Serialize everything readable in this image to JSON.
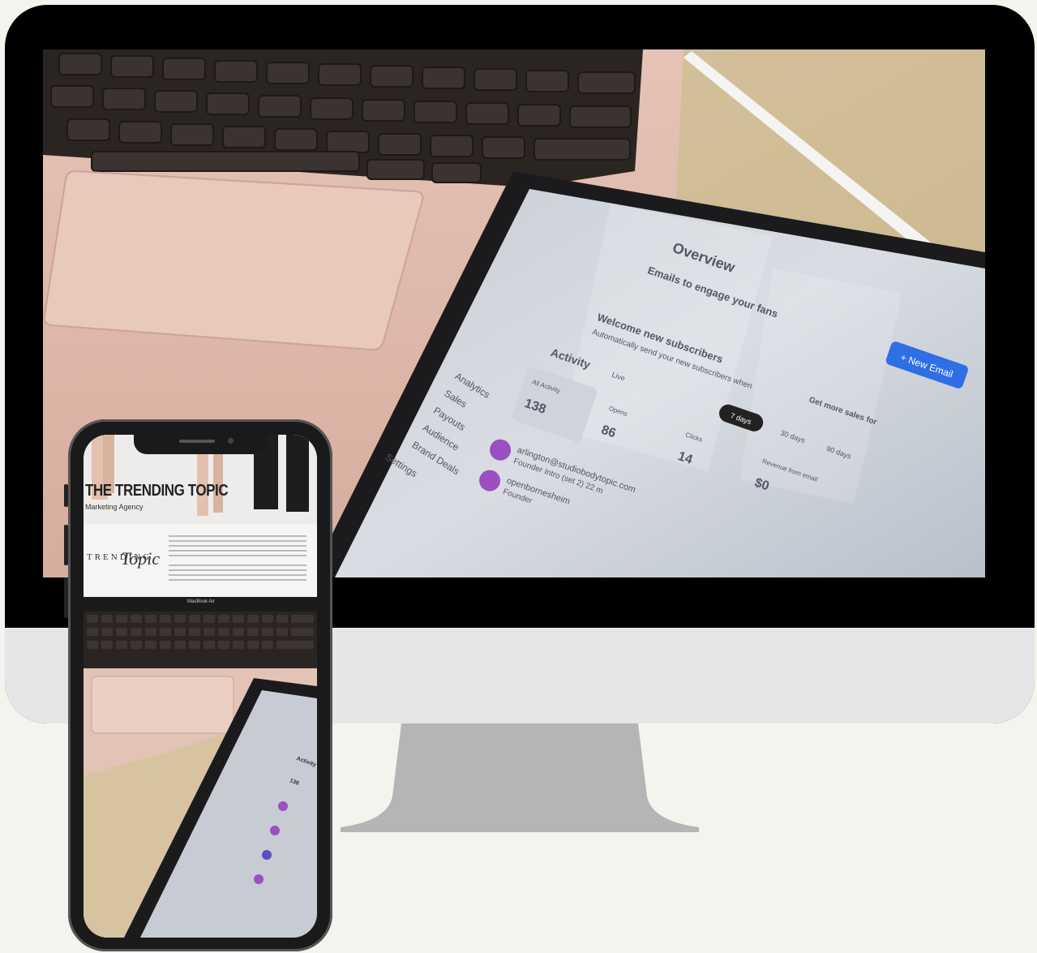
{
  "ipad_screen": {
    "sidebar_items": [
      "Analytics",
      "Sales",
      "Payouts",
      "Audience",
      "Brand Deals",
      "Settings"
    ],
    "title": "Overview",
    "section_title": "Emails to engage your fans",
    "new_email_button": "+ New Email",
    "card_heading": "Welcome new subscribers",
    "card_text": "Automatically send your new subscribers when",
    "activity_label": "Activity",
    "live_label": "Live",
    "range_chips": [
      "7 days",
      "30 days",
      "90 days"
    ],
    "stats": [
      {
        "label": "All Activity",
        "value": "138"
      },
      {
        "label": "Opens",
        "value": "86"
      },
      {
        "label": "Clicks",
        "value": "14"
      },
      {
        "label": "Revenue from email",
        "value": "$0"
      }
    ],
    "activity_rows": [
      {
        "email": "arlington@studiobodytopic.com",
        "detail": "Founder Intro (set 2) 22 m"
      },
      {
        "email": "openbornesheim",
        "detail": "Founder"
      }
    ],
    "promo_text": "Get more sales for"
  },
  "phone_screen": {
    "brand_title": "THE TRENDING TOPIC",
    "brand_subtitle": "Marketing Agency",
    "logo_word": "TRENDING",
    "logo_script": "Topic",
    "laptop_label": "MacBook Air",
    "activity_label": "Activity",
    "activity_value": "138"
  }
}
